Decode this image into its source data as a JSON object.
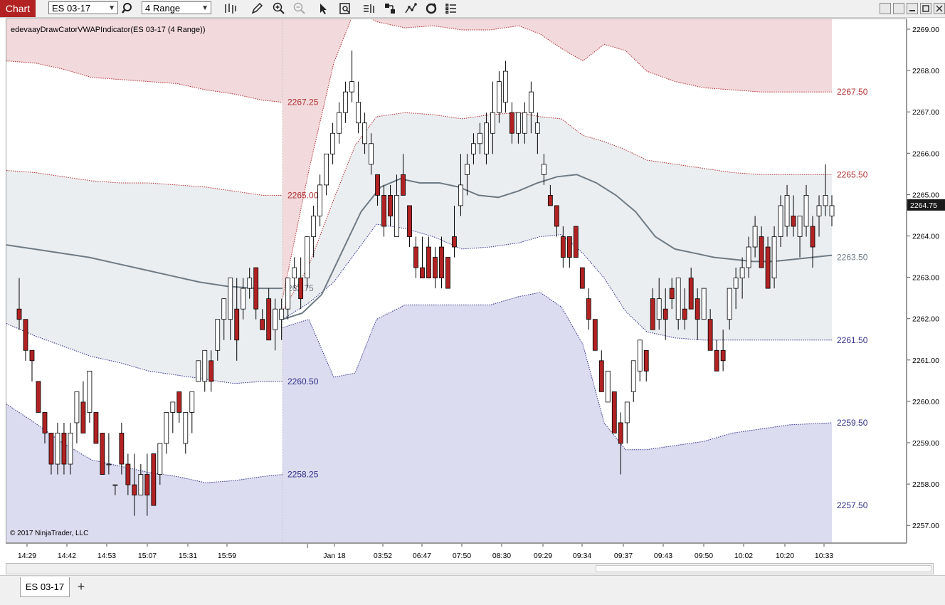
{
  "toolbar": {
    "chart_label": "Chart",
    "instrument": "ES 03-17",
    "bar_type": "4 Range"
  },
  "chart": {
    "indicator_label": "edevaayDrawCatorVWAPIndicator(ES 03-17 (4 Range))",
    "copyright": "© 2017 NinjaTrader, LLC",
    "current_price": "2264.75"
  },
  "bottom": {
    "tab_label": "ES 03-17",
    "add_label": "+"
  },
  "colors": {
    "up_candle": "#ffffff",
    "down_candle": "#b22222",
    "vwap_line": "#6e7b85",
    "upper_band": "#b03030",
    "lower_band": "#30308a",
    "upper_fill": "#f2d9dc",
    "mid_fill": "#ebeef1",
    "lower_fill": "#dcdcf0"
  },
  "chart_data": {
    "type": "candlestick",
    "instrument": "ES 03-17",
    "y_ticks": [
      "2269.00",
      "2268.00",
      "2267.00",
      "2266.00",
      "2265.00",
      "2264.00",
      "2263.00",
      "2262.00",
      "2261.00",
      "2260.00",
      "2259.00",
      "2258.00",
      "2257.00"
    ],
    "ylim": [
      2256.6,
      2269.2
    ],
    "x_ticks": [
      "14:29",
      "14:42",
      "14:53",
      "15:07",
      "15:31",
      "15:59",
      "Jan 18",
      "03:52",
      "06:47",
      "07:50",
      "08:30",
      "09:29",
      "09:34",
      "09:37",
      "09:43",
      "09:50",
      "10:02",
      "10:20",
      "10:33"
    ],
    "first_session_labels": [
      "2267.25",
      "2265.00",
      "262.75",
      "2260.50",
      "2258.25"
    ],
    "second_session_labels": [
      "2267.50",
      "2265.50",
      "2263.50",
      "2261.50",
      "2259.50",
      "2257.50"
    ],
    "candles": [
      {
        "o": 2262.25,
        "h": 2263.0,
        "l": 2261.75,
        "c": 2262.0
      },
      {
        "o": 2262.0,
        "h": 2262.0,
        "l": 2261.0,
        "c": 2261.25
      },
      {
        "o": 2261.25,
        "h": 2261.25,
        "l": 2260.5,
        "c": 2261.0
      },
      {
        "o": 2260.5,
        "h": 2260.5,
        "l": 2259.75,
        "c": 2259.75
      },
      {
        "o": 2259.75,
        "h": 2259.75,
        "l": 2259.0,
        "c": 2259.25
      },
      {
        "o": 2259.25,
        "h": 2259.25,
        "l": 2258.25,
        "c": 2258.5
      },
      {
        "o": 2258.5,
        "h": 2259.5,
        "l": 2258.25,
        "c": 2259.25
      },
      {
        "o": 2259.25,
        "h": 2259.5,
        "l": 2258.25,
        "c": 2258.5
      },
      {
        "o": 2258.5,
        "h": 2259.5,
        "l": 2258.25,
        "c": 2259.25
      },
      {
        "o": 2259.5,
        "h": 2260.25,
        "l": 2259.0,
        "c": 2260.25
      },
      {
        "o": 2260.0,
        "h": 2260.5,
        "l": 2259.25,
        "c": 2259.25
      },
      {
        "o": 2259.75,
        "h": 2260.75,
        "l": 2259.5,
        "c": 2260.75
      },
      {
        "o": 2259.75,
        "h": 2259.75,
        "l": 2259.0,
        "c": 2259.0
      },
      {
        "o": 2259.25,
        "h": 2259.25,
        "l": 2258.25,
        "c": 2258.25
      },
      {
        "o": 2258.5,
        "h": 2259.25,
        "l": 2258.25,
        "c": 2258.5
      },
      {
        "o": 2258.0,
        "h": 2258.0,
        "l": 2257.75,
        "c": 2258.0
      },
      {
        "o": 2259.25,
        "h": 2259.5,
        "l": 2258.25,
        "c": 2258.5
      },
      {
        "o": 2258.5,
        "h": 2258.75,
        "l": 2257.75,
        "c": 2258.0
      },
      {
        "o": 2258.0,
        "h": 2258.75,
        "l": 2257.25,
        "c": 2257.75
      },
      {
        "o": 2257.75,
        "h": 2258.5,
        "l": 2257.75,
        "c": 2258.25
      },
      {
        "o": 2258.25,
        "h": 2258.75,
        "l": 2257.25,
        "c": 2257.75
      },
      {
        "o": 2258.75,
        "h": 2258.75,
        "l": 2257.5,
        "c": 2257.5
      },
      {
        "o": 2258.25,
        "h": 2259.0,
        "l": 2258.0,
        "c": 2259.0
      },
      {
        "o": 2259.0,
        "h": 2259.75,
        "l": 2258.75,
        "c": 2259.75
      },
      {
        "o": 2259.75,
        "h": 2260.0,
        "l": 2259.25,
        "c": 2260.0
      },
      {
        "o": 2260.25,
        "h": 2260.25,
        "l": 2259.5,
        "c": 2259.75
      },
      {
        "o": 2259.0,
        "h": 2259.75,
        "l": 2258.75,
        "c": 2259.75
      },
      {
        "o": 2259.75,
        "h": 2260.25,
        "l": 2259.25,
        "c": 2260.25
      },
      {
        "o": 2260.5,
        "h": 2261.0,
        "l": 2260.5,
        "c": 2261.0
      },
      {
        "o": 2260.5,
        "h": 2261.25,
        "l": 2260.25,
        "c": 2261.25
      },
      {
        "o": 2261.0,
        "h": 2261.25,
        "l": 2260.25,
        "c": 2260.5
      },
      {
        "o": 2261.25,
        "h": 2262.0,
        "l": 2261.0,
        "c": 2262.0
      },
      {
        "o": 2262.0,
        "h": 2262.5,
        "l": 2261.5,
        "c": 2262.5
      },
      {
        "o": 2262.0,
        "h": 2263.0,
        "l": 2261.5,
        "c": 2263.0
      },
      {
        "o": 2262.25,
        "h": 2263.0,
        "l": 2261.0,
        "c": 2261.5
      },
      {
        "o": 2262.25,
        "h": 2263.0,
        "l": 2262.0,
        "c": 2262.75
      },
      {
        "o": 2262.75,
        "h": 2263.25,
        "l": 2262.5,
        "c": 2263.0
      },
      {
        "o": 2263.25,
        "h": 2263.25,
        "l": 2262.0,
        "c": 2262.25
      },
      {
        "o": 2262.0,
        "h": 2262.25,
        "l": 2261.75,
        "c": 2261.75
      },
      {
        "o": 2262.5,
        "h": 2262.75,
        "l": 2261.5,
        "c": 2261.5
      },
      {
        "o": 2261.75,
        "h": 2262.5,
        "l": 2261.25,
        "c": 2262.25
      },
      {
        "o": 2262.0,
        "h": 2262.5,
        "l": 2261.5,
        "c": 2262.25
      },
      {
        "o": 2262.25,
        "h": 2263.0,
        "l": 2262.0,
        "c": 2263.0
      },
      {
        "o": 2263.0,
        "h": 2263.5,
        "l": 2262.75,
        "c": 2263.25
      },
      {
        "o": 2263.0,
        "h": 2263.5,
        "l": 2262.25,
        "c": 2262.5
      },
      {
        "o": 2263.0,
        "h": 2264.0,
        "l": 2262.75,
        "c": 2264.0
      },
      {
        "o": 2264.0,
        "h": 2264.75,
        "l": 2263.5,
        "c": 2264.5
      },
      {
        "o": 2264.5,
        "h": 2265.5,
        "l": 2264.25,
        "c": 2265.25
      },
      {
        "o": 2265.25,
        "h": 2266.0,
        "l": 2265.0,
        "c": 2266.0
      },
      {
        "o": 2266.0,
        "h": 2266.75,
        "l": 2265.75,
        "c": 2266.5
      },
      {
        "o": 2266.5,
        "h": 2267.25,
        "l": 2266.25,
        "c": 2267.0
      },
      {
        "o": 2267.0,
        "h": 2267.75,
        "l": 2266.75,
        "c": 2267.5
      },
      {
        "o": 2267.5,
        "h": 2268.5,
        "l": 2267.25,
        "c": 2267.75
      },
      {
        "o": 2266.75,
        "h": 2267.75,
        "l": 2266.5,
        "c": 2267.25
      },
      {
        "o": 2266.25,
        "h": 2267.0,
        "l": 2266.0,
        "c": 2266.75
      },
      {
        "o": 2265.75,
        "h": 2266.5,
        "l": 2265.5,
        "c": 2266.25
      },
      {
        "o": 2265.5,
        "h": 2265.5,
        "l": 2264.75,
        "c": 2265.0
      },
      {
        "o": 2265.0,
        "h": 2265.25,
        "l": 2264.0,
        "c": 2264.25
      },
      {
        "o": 2265.0,
        "h": 2265.25,
        "l": 2264.25,
        "c": 2264.5
      },
      {
        "o": 2264.0,
        "h": 2265.5,
        "l": 2264.0,
        "c": 2265.0
      },
      {
        "o": 2265.5,
        "h": 2266.0,
        "l": 2265.0,
        "c": 2265.0
      },
      {
        "o": 2264.75,
        "h": 2264.75,
        "l": 2263.75,
        "c": 2264.0
      },
      {
        "o": 2263.75,
        "h": 2264.0,
        "l": 2263.0,
        "c": 2263.25
      },
      {
        "o": 2263.25,
        "h": 2264.0,
        "l": 2263.0,
        "c": 2263.0
      },
      {
        "o": 2263.75,
        "h": 2264.0,
        "l": 2263.0,
        "c": 2263.0
      },
      {
        "o": 2263.5,
        "h": 2263.75,
        "l": 2262.75,
        "c": 2263.0
      },
      {
        "o": 2263.75,
        "h": 2264.0,
        "l": 2262.75,
        "c": 2263.0
      },
      {
        "o": 2263.5,
        "h": 2263.5,
        "l": 2262.75,
        "c": 2262.75
      },
      {
        "o": 2264.0,
        "h": 2264.75,
        "l": 2263.5,
        "c": 2263.75
      },
      {
        "o": 2264.75,
        "h": 2266.0,
        "l": 2264.5,
        "c": 2265.25
      },
      {
        "o": 2265.5,
        "h": 2266.0,
        "l": 2265.0,
        "c": 2265.75
      },
      {
        "o": 2266.0,
        "h": 2266.5,
        "l": 2265.75,
        "c": 2266.25
      },
      {
        "o": 2266.25,
        "h": 2266.75,
        "l": 2266.0,
        "c": 2266.5
      },
      {
        "o": 2266.0,
        "h": 2267.0,
        "l": 2265.75,
        "c": 2266.75
      },
      {
        "o": 2266.5,
        "h": 2267.75,
        "l": 2266.0,
        "c": 2267.0
      },
      {
        "o": 2267.0,
        "h": 2268.0,
        "l": 2266.75,
        "c": 2267.75
      },
      {
        "o": 2267.25,
        "h": 2268.25,
        "l": 2267.0,
        "c": 2268.0
      },
      {
        "o": 2267.0,
        "h": 2267.25,
        "l": 2266.25,
        "c": 2266.5
      },
      {
        "o": 2266.5,
        "h": 2267.0,
        "l": 2266.25,
        "c": 2267.0
      },
      {
        "o": 2266.5,
        "h": 2267.25,
        "l": 2266.25,
        "c": 2267.0
      },
      {
        "o": 2267.0,
        "h": 2267.75,
        "l": 2266.5,
        "c": 2267.5
      },
      {
        "o": 2266.5,
        "h": 2267.0,
        "l": 2266.0,
        "c": 2266.75
      },
      {
        "o": 2265.5,
        "h": 2266.0,
        "l": 2265.25,
        "c": 2265.75
      },
      {
        "o": 2265.0,
        "h": 2265.25,
        "l": 2264.75,
        "c": 2264.75
      },
      {
        "o": 2264.75,
        "h": 2264.75,
        "l": 2264.0,
        "c": 2264.25
      },
      {
        "o": 2264.0,
        "h": 2264.25,
        "l": 2263.25,
        "c": 2263.5
      },
      {
        "o": 2264.0,
        "h": 2264.0,
        "l": 2263.25,
        "c": 2263.5
      },
      {
        "o": 2264.25,
        "h": 2264.25,
        "l": 2263.5,
        "c": 2263.5
      },
      {
        "o": 2263.25,
        "h": 2263.25,
        "l": 2262.75,
        "c": 2262.75
      },
      {
        "o": 2262.5,
        "h": 2262.75,
        "l": 2261.75,
        "c": 2262.0
      },
      {
        "o": 2262.0,
        "h": 2262.0,
        "l": 2261.25,
        "c": 2261.25
      },
      {
        "o": 2261.0,
        "h": 2261.25,
        "l": 2260.25,
        "c": 2260.25
      },
      {
        "o": 2260.0,
        "h": 2260.75,
        "l": 2260.0,
        "c": 2260.75
      },
      {
        "o": 2260.25,
        "h": 2260.25,
        "l": 2259.25,
        "c": 2259.25
      },
      {
        "o": 2259.5,
        "h": 2259.75,
        "l": 2258.25,
        "c": 2259.0
      },
      {
        "o": 2259.5,
        "h": 2260.0,
        "l": 2259.0,
        "c": 2260.0
      },
      {
        "o": 2260.25,
        "h": 2261.0,
        "l": 2260.0,
        "c": 2261.0
      },
      {
        "o": 2260.75,
        "h": 2261.5,
        "l": 2260.5,
        "c": 2261.5
      },
      {
        "o": 2261.25,
        "h": 2261.25,
        "l": 2260.5,
        "c": 2260.75
      },
      {
        "o": 2262.5,
        "h": 2262.75,
        "l": 2261.75,
        "c": 2261.75
      },
      {
        "o": 2262.0,
        "h": 2263.0,
        "l": 2261.75,
        "c": 2262.5
      },
      {
        "o": 2262.25,
        "h": 2262.75,
        "l": 2261.5,
        "c": 2262.0
      },
      {
        "o": 2262.75,
        "h": 2263.0,
        "l": 2262.25,
        "c": 2262.5
      },
      {
        "o": 2262.0,
        "h": 2263.0,
        "l": 2261.75,
        "c": 2263.0
      },
      {
        "o": 2262.25,
        "h": 2262.75,
        "l": 2261.75,
        "c": 2262.0
      },
      {
        "o": 2263.0,
        "h": 2263.25,
        "l": 2262.25,
        "c": 2262.25
      },
      {
        "o": 2262.5,
        "h": 2262.75,
        "l": 2261.5,
        "c": 2262.0
      },
      {
        "o": 2262.0,
        "h": 2262.75,
        "l": 2262.0,
        "c": 2262.75
      },
      {
        "o": 2262.0,
        "h": 2262.25,
        "l": 2261.25,
        "c": 2261.25
      },
      {
        "o": 2261.25,
        "h": 2261.5,
        "l": 2260.75,
        "c": 2260.75
      },
      {
        "o": 2261.25,
        "h": 2261.75,
        "l": 2260.75,
        "c": 2261.0
      },
      {
        "o": 2262.0,
        "h": 2262.75,
        "l": 2261.75,
        "c": 2262.75
      },
      {
        "o": 2262.75,
        "h": 2263.25,
        "l": 2262.25,
        "c": 2263.0
      },
      {
        "o": 2263.0,
        "h": 2263.5,
        "l": 2262.5,
        "c": 2263.25
      },
      {
        "o": 2263.25,
        "h": 2264.0,
        "l": 2263.0,
        "c": 2263.75
      },
      {
        "o": 2263.75,
        "h": 2264.5,
        "l": 2263.5,
        "c": 2264.25
      },
      {
        "o": 2264.0,
        "h": 2264.25,
        "l": 2263.25,
        "c": 2263.25
      },
      {
        "o": 2263.75,
        "h": 2264.0,
        "l": 2262.75,
        "c": 2262.75
      },
      {
        "o": 2263.0,
        "h": 2264.25,
        "l": 2262.75,
        "c": 2264.0
      },
      {
        "o": 2264.0,
        "h": 2265.0,
        "l": 2263.75,
        "c": 2264.75
      },
      {
        "o": 2264.25,
        "h": 2265.25,
        "l": 2264.0,
        "c": 2265.0
      },
      {
        "o": 2264.5,
        "h": 2265.0,
        "l": 2264.0,
        "c": 2264.25
      },
      {
        "o": 2264.0,
        "h": 2264.5,
        "l": 2263.5,
        "c": 2264.5
      },
      {
        "o": 2264.25,
        "h": 2265.25,
        "l": 2264.0,
        "c": 2265.0
      },
      {
        "o": 2264.25,
        "h": 2264.5,
        "l": 2263.25,
        "c": 2263.75
      },
      {
        "o": 2264.5,
        "h": 2265.0,
        "l": 2264.0,
        "c": 2264.75
      },
      {
        "o": 2264.75,
        "h": 2265.75,
        "l": 2264.5,
        "c": 2265.0
      },
      {
        "o": 2264.5,
        "h": 2265.0,
        "l": 2264.25,
        "c": 2264.75
      }
    ],
    "vwap_series": {
      "session1": [
        2263.8,
        2263.7,
        2263.6,
        2263.5,
        2263.35,
        2263.2,
        2263.05,
        2262.9,
        2262.8,
        2262.75,
        2262.75
      ],
      "session2": [
        2262.0,
        2262.15,
        2262.6,
        2263.6,
        2264.6,
        2265.2,
        2265.4,
        2265.3,
        2265.3,
        2265.2,
        2265.0,
        2264.95,
        2265.1,
        2265.3,
        2265.45,
        2265.5,
        2265.3,
        2265.0,
        2264.6,
        2264.0,
        2263.7,
        2263.6,
        2263.5,
        2263.45,
        2263.4,
        2263.4,
        2263.45,
        2263.5,
        2263.55
      ]
    }
  }
}
